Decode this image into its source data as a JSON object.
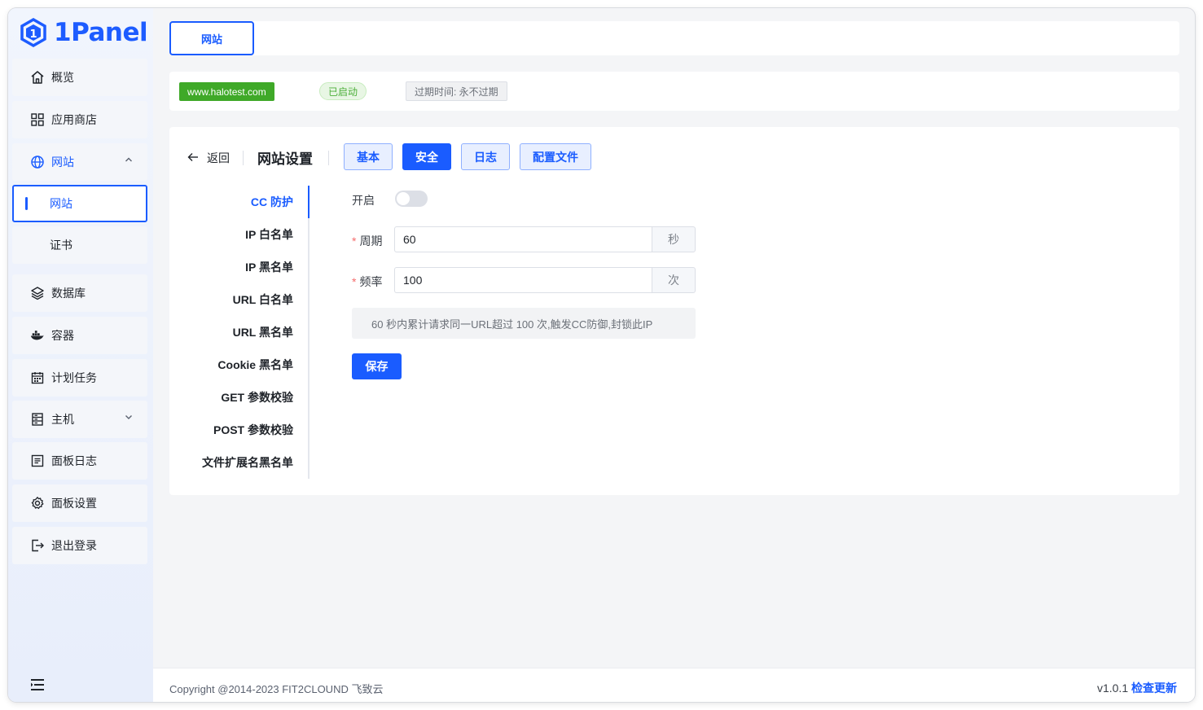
{
  "app": {
    "logo_text": "1Panel"
  },
  "sidebar": {
    "items": [
      {
        "label": "概览",
        "icon": "home-icon"
      },
      {
        "label": "应用商店",
        "icon": "grid-icon"
      },
      {
        "label": "网站",
        "icon": "globe-icon",
        "expanded": true
      },
      {
        "label": "网站",
        "sub": true,
        "selected": true
      },
      {
        "label": "证书",
        "sub": true
      },
      {
        "label": "数据库",
        "icon": "layers-icon"
      },
      {
        "label": "容器",
        "icon": "docker-icon"
      },
      {
        "label": "计划任务",
        "icon": "calendar-icon"
      },
      {
        "label": "主机",
        "icon": "server-icon",
        "chevron": "down"
      },
      {
        "label": "面板日志",
        "icon": "log-icon"
      },
      {
        "label": "面板设置",
        "icon": "gear-icon"
      },
      {
        "label": "退出登录",
        "icon": "logout-icon"
      }
    ]
  },
  "topbar": {
    "tab_label": "网站"
  },
  "site": {
    "domain": "www.halotest.com",
    "status": "已启动",
    "expire": "过期时间: 永不过期"
  },
  "header": {
    "back_label": "返回",
    "title": "网站设置",
    "tabs": [
      "基本",
      "安全",
      "日志",
      "配置文件"
    ],
    "active_tab": "安全"
  },
  "security_nav": {
    "items": [
      "CC 防护",
      "IP 白名单",
      "IP 黑名单",
      "URL 白名单",
      "URL 黑名单",
      "Cookie 黑名单",
      "GET 参数校验",
      "POST 参数校验",
      "文件扩展名黑名单"
    ],
    "active": "CC 防护"
  },
  "form": {
    "enable_label": "开启",
    "enabled": false,
    "period_label": "周期",
    "period_value": "60",
    "period_unit": "秒",
    "freq_label": "频率",
    "freq_value": "100",
    "freq_unit": "次",
    "hint": "60 秒内累计请求同一URL超过 100 次,触发CC防御,封锁此IP",
    "save_label": "保存"
  },
  "footer": {
    "copyright": "Copyright @2014-2023 FIT2CLOUND 飞致云",
    "version": "v1.0.1",
    "update_label": "检查更新"
  },
  "colors": {
    "accent": "#1a5cff",
    "success": "#3fa928",
    "danger": "#f56c6c"
  }
}
